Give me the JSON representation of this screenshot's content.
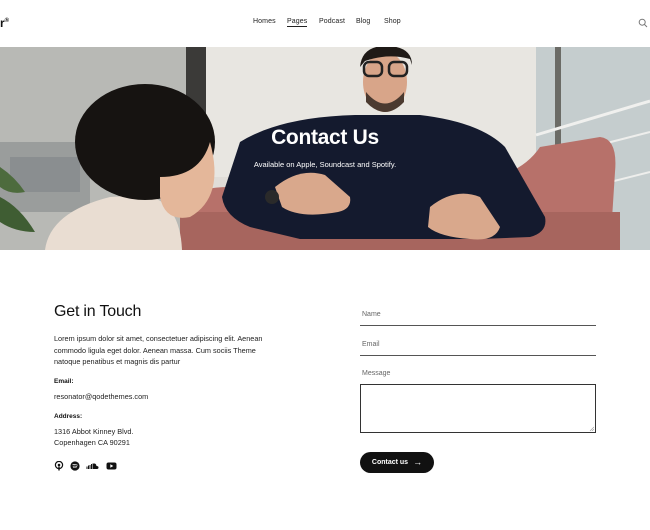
{
  "header": {
    "logo_text": "r",
    "logo_mark": "®",
    "nav": [
      {
        "label": "Homes",
        "active": false
      },
      {
        "label": "Pages",
        "active": true
      },
      {
        "label": "Podcast",
        "active": false
      },
      {
        "label": "Blog",
        "active": false
      },
      {
        "label": "Shop",
        "active": false
      }
    ],
    "search_icon": "search-icon"
  },
  "hero": {
    "title": "Contact Us",
    "subtitle": "Available on Apple, Soundcast and Spotify."
  },
  "contact": {
    "title": "Get in Touch",
    "description": "Lorem ipsum dolor sit amet, consectetuer adipiscing elit. Aenean commodo ligula eget dolor. Aenean massa. Cum sociis Theme natoque penatibus et magnis dis partur",
    "email_label": "Email:",
    "email_value": "resonator@qodethemes.com",
    "address_label": "Address:",
    "address_line1": "1316 Abbot Kinney Blvd.",
    "address_line2": "Copenhagen CA 90291",
    "socials": [
      "podcast-icon",
      "spotify-icon",
      "soundcloud-icon",
      "youtube-icon"
    ]
  },
  "form": {
    "name_placeholder": "Name",
    "email_placeholder": "Email",
    "message_placeholder": "Message",
    "submit_label": "Contact us"
  }
}
